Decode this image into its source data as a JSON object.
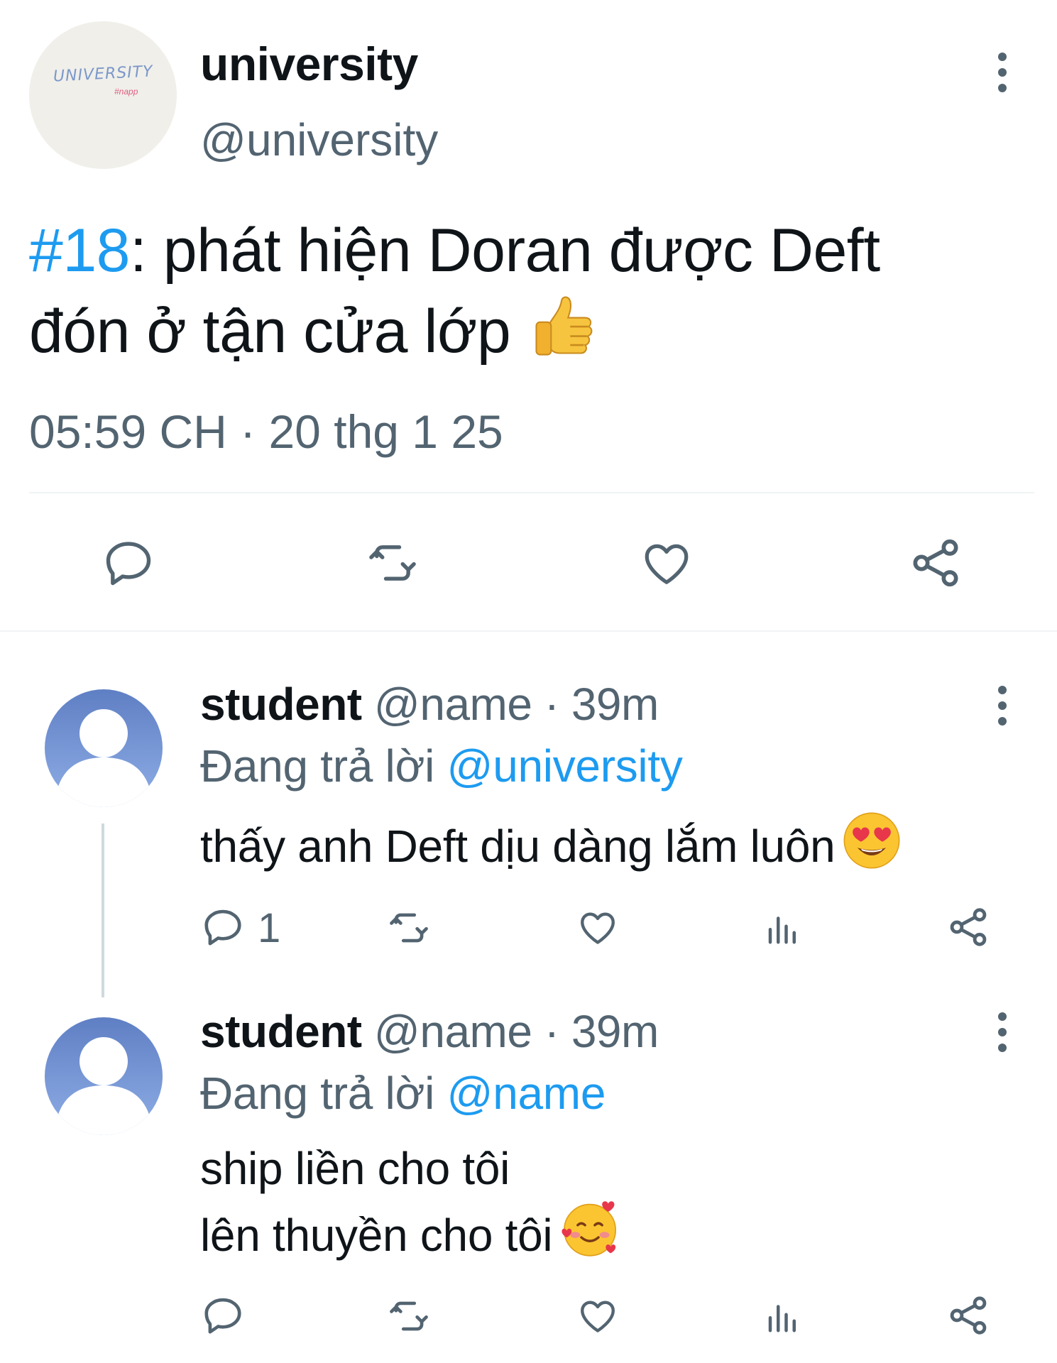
{
  "main_tweet": {
    "avatar_logo": "UNIVERSITY",
    "avatar_logo_sub": "#napp",
    "display_name": "university",
    "handle": "@university",
    "hashtag": "#18",
    "text_line1": ": phát hiện Doran được Deft",
    "text_line2": "đón ở tận cửa lớp",
    "emoji": "thumbs-up",
    "timestamp": "05:59 CH · 20 thg 1 25",
    "actions": [
      "reply-icon",
      "retweet-icon",
      "like-icon",
      "share-icon"
    ]
  },
  "replies": [
    {
      "display_name": "student",
      "handle": "@name",
      "time": "39m",
      "replying_label": "Đang trả lời",
      "replying_to": "@university",
      "lines": [
        "thấy anh Deft dịu dàng lắm luôn"
      ],
      "emoji": "heart-eyes",
      "reply_count": "1",
      "actions": [
        "reply-icon",
        "retweet-icon",
        "like-icon",
        "views-icon",
        "share-icon"
      ]
    },
    {
      "display_name": "student",
      "handle": "@name",
      "time": "39m",
      "replying_label": "Đang trả lời",
      "replying_to": "@name",
      "lines": [
        "ship liền cho tôi",
        "lên thuyền cho tôi"
      ],
      "emoji": "smiling-face-with-hearts",
      "reply_count": "",
      "actions": [
        "reply-icon",
        "retweet-icon",
        "like-icon",
        "views-icon",
        "share-icon"
      ]
    }
  ],
  "colors": {
    "text": "#0f1419",
    "secondary": "#536471",
    "accent": "#1d9bf0",
    "divider": "#eff3f4",
    "avatar_gradient_top": "#5f7fc4",
    "avatar_gradient_bottom": "#8faee6"
  }
}
